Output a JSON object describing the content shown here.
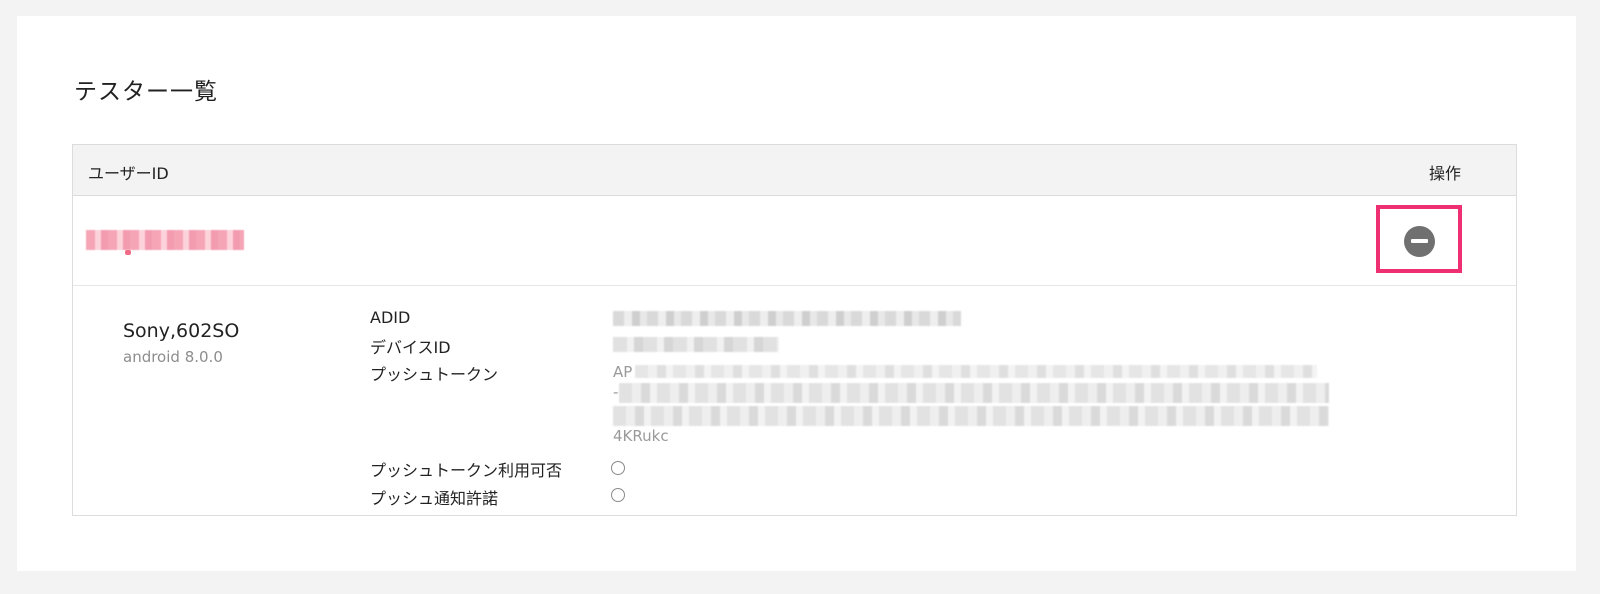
{
  "page": {
    "title": "テスター一覧"
  },
  "table": {
    "headers": {
      "user_id": "ユーザーID",
      "actions": "操作"
    }
  },
  "tester": {
    "user_id": "",
    "remove_icon": "minus-circle-icon",
    "device": {
      "name": "Sony,602SO",
      "os": "android 8.0.0"
    },
    "details": {
      "adid_label": "ADID",
      "device_id_label": "デバイスID",
      "push_token_label": "プッシュトークン",
      "push_token_visible_line1": "AP",
      "push_token_visible_line2": "-",
      "push_token_tail": "4KRukc",
      "push_token_available_label": "プッシュトークン利用可否",
      "push_permission_label": "プッシュ通知許諾"
    }
  },
  "colors": {
    "highlight": "#ee2f72",
    "remove_button": "#707070"
  }
}
